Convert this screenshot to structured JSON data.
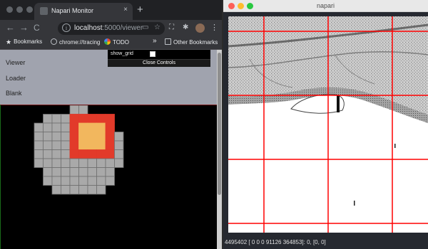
{
  "chrome": {
    "tab_title": "Napari Monitor",
    "tab_close": "×",
    "new_tab": "+",
    "nav": {
      "back": "←",
      "forward": "→",
      "reload": "C"
    },
    "url_host": "localhost",
    "url_path": ":5000/viewer",
    "bookmarks": [
      {
        "label": "Bookmarks",
        "icon": "star-icon"
      },
      {
        "label": "chrome://tracing",
        "icon": "globe-icon"
      },
      {
        "label": "TODO",
        "icon": "google-icon"
      }
    ],
    "bookmarks_overflow": "»",
    "other_bookmarks": "Other Bookmarks"
  },
  "page": {
    "links": [
      "Viewer",
      "Loader",
      "Blank"
    ],
    "controls": {
      "show_grid_label": "show_grid",
      "close_label": "Close Controls"
    }
  },
  "tiles": {
    "colors": {
      "gray": "#a9a9a9",
      "red": "#e23a2a",
      "orange": "#f2b75e",
      "grid": "#6e6e6e"
    },
    "rows": [
      {
        "start": 6,
        "end": 8
      },
      {
        "start": 3,
        "end": 11
      },
      {
        "start": 2,
        "end": 11
      },
      {
        "start": 2,
        "end": 12
      },
      {
        "start": 2,
        "end": 12
      },
      {
        "start": 2,
        "end": 12
      },
      {
        "start": 2,
        "end": 12
      },
      {
        "start": 3,
        "end": 11
      },
      {
        "start": 3,
        "end": 11
      },
      {
        "start": 4,
        "end": 10
      }
    ]
  },
  "napari": {
    "window_title": "napari",
    "status": "4495402 [   0     0     0   91126 364853]: 0, [0, 0]",
    "grid_color": "#ff0000"
  }
}
